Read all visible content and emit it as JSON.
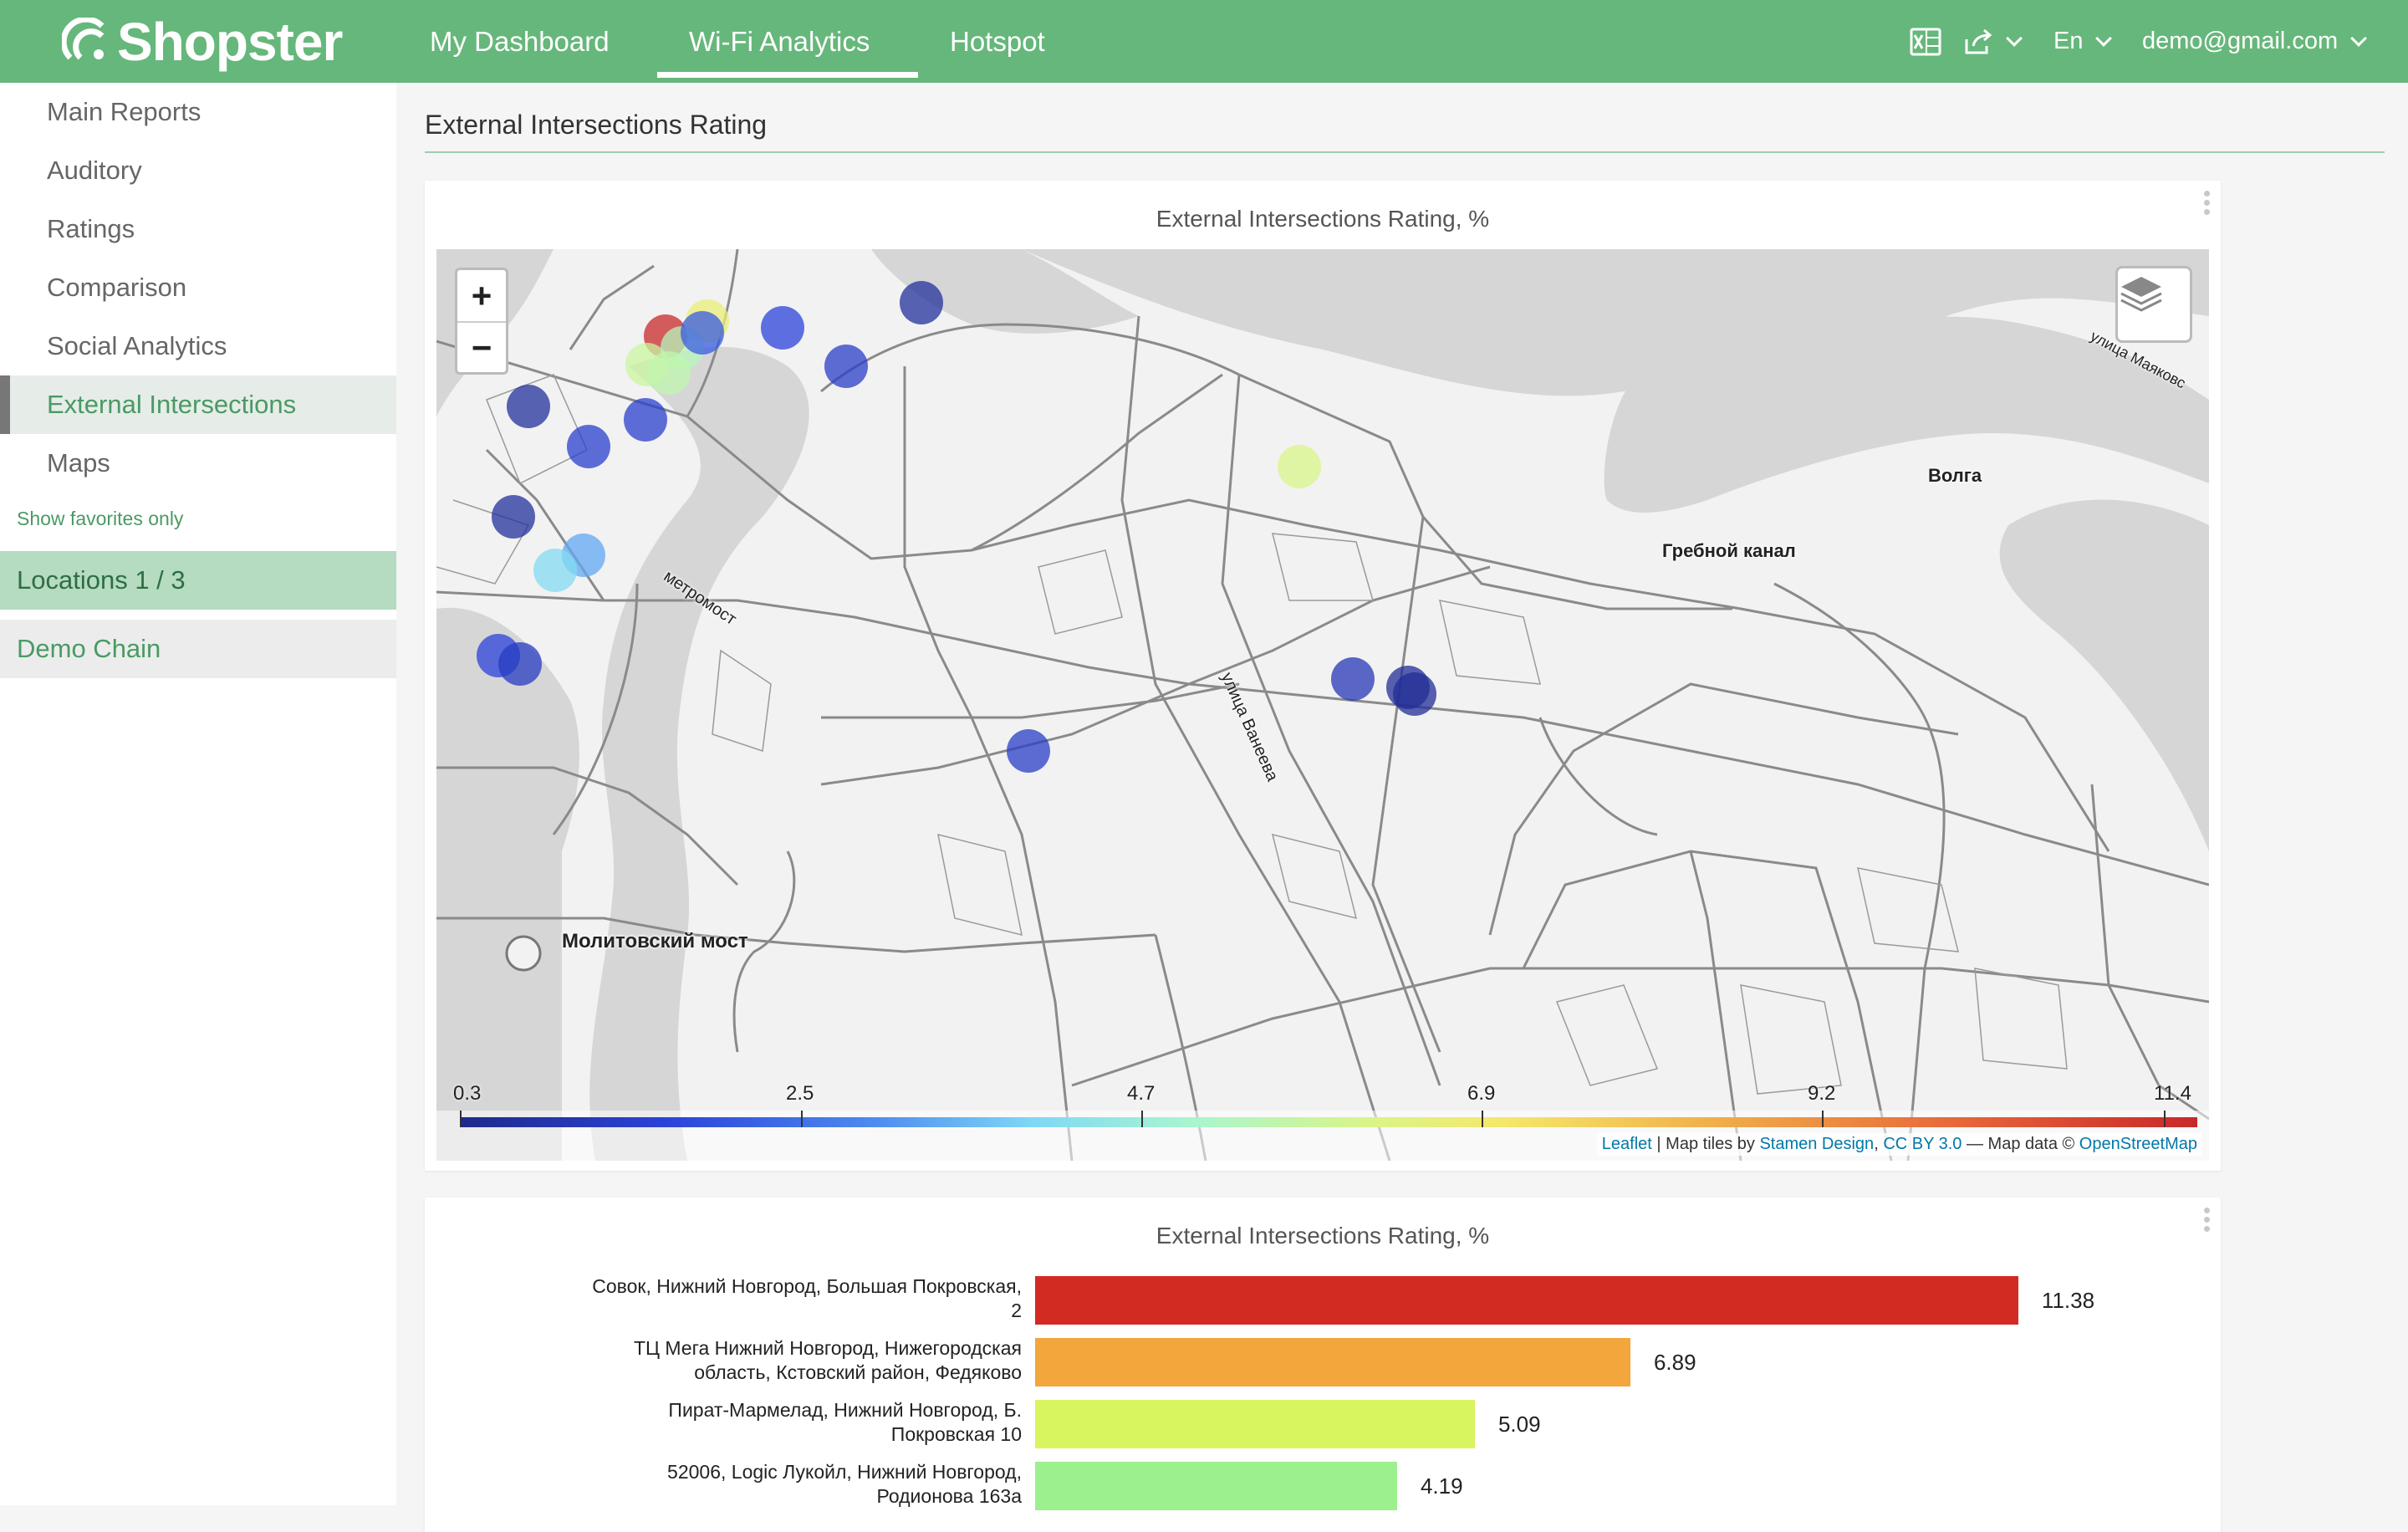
{
  "app": {
    "logo_text": "Shopster",
    "nav": [
      "My Dashboard",
      "Wi-Fi Analytics",
      "Hotspot"
    ],
    "active_nav": "Wi-Fi Analytics",
    "language": "En",
    "user": "demo@gmail.com"
  },
  "sidebar": {
    "items": [
      "Main Reports",
      "Auditory",
      "Ratings",
      "Comparison",
      "Social Analytics",
      "External Intersections",
      "Maps"
    ],
    "active": "External Intersections",
    "favorites_link": "Show favorites only",
    "locations": "Locations 1 / 3",
    "chain": "Demo Chain"
  },
  "page": {
    "title": "External Intersections Rating"
  },
  "map_card": {
    "title": "External Intersections Rating, %",
    "zoom_in": "+",
    "zoom_out": "−",
    "labels": {
      "volga": "Волга",
      "grebnoy": "Гребной канал",
      "metromost": "метромост",
      "molitovsky": "Молитовский мост",
      "vaneeva": "улица Ванеева",
      "mayakovsk": "улица Маяковс"
    },
    "colorbar": {
      "ticks": [
        "0.3",
        "2.5",
        "4.7",
        "6.9",
        "9.2",
        "11.4"
      ]
    },
    "attribution": {
      "leaflet": "Leaflet",
      "sep1": " | Map tiles by ",
      "stamen": "Stamen Design",
      "sep2": ", ",
      "ccby": "CC BY 3.0",
      "sep3": " — Map data © ",
      "osm": "OpenStreetMap"
    }
  },
  "bar_card": {
    "title": "External Intersections Rating, %"
  },
  "chart_data": {
    "type": "bar",
    "orientation": "horizontal",
    "title": "External Intersections Rating, %",
    "categories": [
      [
        "Совок, Нижний Новгород, Большая Покровская,",
        "2"
      ],
      [
        "ТЦ Мега Нижний Новгород, Нижегородская",
        "область, Кстовский район, Федяково"
      ],
      [
        "Пират-Мармелад, Нижний Новгород, Б.",
        "Покровская 10"
      ],
      [
        "52006, Logic Лукойл, Нижний Новгород,",
        "Родионова 163а"
      ]
    ],
    "values": [
      11.38,
      6.89,
      5.09,
      4.19
    ],
    "value_labels": [
      "11.38",
      "6.89",
      "5.09",
      "4.19"
    ],
    "colors": [
      "#d12b22",
      "#f2a63c",
      "#d8f55f",
      "#9df08e"
    ],
    "xlim": [
      0,
      12
    ]
  },
  "map_points": {
    "description_values": [
      11.4,
      6.5,
      5.6,
      5.2,
      5.4,
      2.0,
      1.6,
      1.3,
      0.6,
      0.6,
      1.4,
      1.4,
      3.2,
      0.6,
      4.0,
      1.6,
      1.2,
      5.9,
      1.0,
      0.5,
      0.5,
      1.3
    ]
  }
}
